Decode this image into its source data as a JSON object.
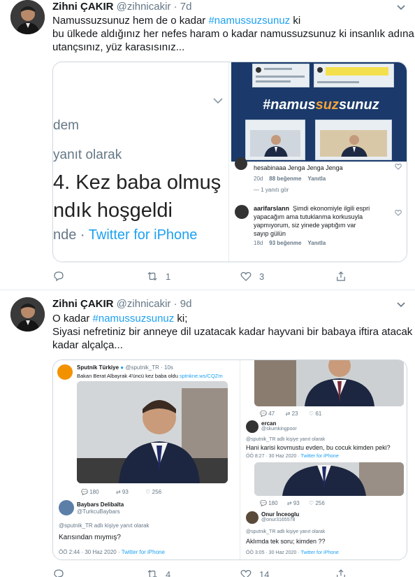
{
  "tweets": [
    {
      "author_name": "Zihni ÇAKIR",
      "handle": "@zihnicakir",
      "separator": "·",
      "time": "7d",
      "text_lines": [
        {
          "pre": "Namussuzsunuz hem de o kadar ",
          "tag": "#namussuzsunuz",
          "post": " ki"
        },
        {
          "pre": "bu ülkede aldığınız her nefes haram o kadar namussuzsunuz ki insanlık adına",
          "tag": "",
          "post": ""
        },
        {
          "pre": "utançsınız, yüz karasısınız...",
          "tag": "",
          "post": ""
        }
      ],
      "media": {
        "left_text": {
          "l1": "dem",
          "l2": "yanıt olarak",
          "l3": "4. Kez baba olmuş",
          "l4": "ndık hoşgeldi",
          "l5_pre": "nde · ",
          "l5_link": "Twitter for iPhone"
        },
        "banner_hash_white": "#namus",
        "banner_hash_orange": "suz",
        "banner_hash_white2": "sunuz",
        "comment1": {
          "text": "hesabinaaa Jenga Jenga Jenga",
          "time": "20d",
          "likes": "88 beğenme",
          "reply": "Yanıtla"
        },
        "show_replies": "1 yanıtı gör",
        "comment2": {
          "user": "aarifarslann",
          "line1": "Şimdi ekonomiyle ilgili espri",
          "line2": "yapacağım ama tutuklanma korkusuyla",
          "line3": "yapmıyorum, siz yinede yaptığım var",
          "line4": "sayıp gülün",
          "time": "18d",
          "likes": "93 beğenme",
          "reply": "Yanıtla"
        }
      },
      "actions": {
        "replies": "",
        "retweets": "1",
        "likes": "3"
      }
    },
    {
      "author_name": "Zihni ÇAKIR",
      "handle": "@zihnicakir",
      "separator": "·",
      "time": "9d",
      "text_lines": [
        {
          "pre": "O kadar ",
          "tag": "#namussuzsunuz",
          "post": " ki;"
        },
        {
          "pre": "Siyasi nefretiniz bir anneye dil uzatacak kadar hayvani bir babaya iftira atacak",
          "tag": "",
          "post": ""
        },
        {
          "pre": "kadar alçalça...",
          "tag": "",
          "post": ""
        }
      ],
      "media": {
        "left": {
          "account": "Sputnik Türkiye",
          "account_handle": "@sputnik_TR · 10s",
          "news": "Bakan Berat Albayrak 4'üncü kez baba oldu ",
          "news_link": "sptnkne.ws/CQZm",
          "stat1": "180",
          "stat2": "93",
          "stat3": "256",
          "reply_user": "Baybars Delibalta",
          "reply_handle": "@TurkcuBaybars",
          "reply_context": "@sputnik_TR adlı kişiye yanıt olarak",
          "reply_text": "Karısından mıymış?",
          "reply_meta": "ÖÖ 2:44 · 30 Haz 2020 · ",
          "reply_meta_link": "Twitter for iPhone"
        },
        "right": {
          "stat_a": "47",
          "stat_b": "23",
          "stat_c": "61",
          "u1": "ercan",
          "u1_handle": "@skumkingpoor",
          "u1_context": "@sputnik_TR adlı kişiye yanıt olarak",
          "u1_text": "Hani karisi kovmustu evden, bu cocuk kimden peki?",
          "u1_meta": "ÖÖ 8:27 · 30 Haz 2020 · ",
          "u1_meta_link": "Twitter for iPhone",
          "stat_d": "180",
          "stat_e": "93",
          "stat_f": "256",
          "u2": "Onur İnceoglu",
          "u2_handle": "@onur3165578",
          "u2_context": "@sputnik_TR adlı kişiye yanıt olarak",
          "u2_text": "Aklımda tek soru;  kimden ??",
          "u2_meta": "ÖÖ 3:05 · 30 Haz 2020 · ",
          "u2_meta_link": "Twitter for iPhone"
        }
      },
      "actions": {
        "replies": "",
        "retweets": "4",
        "likes": "14"
      }
    }
  ],
  "colors": {
    "link": "#1da1f2",
    "muted": "#657786",
    "border": "#e6ecf0"
  }
}
